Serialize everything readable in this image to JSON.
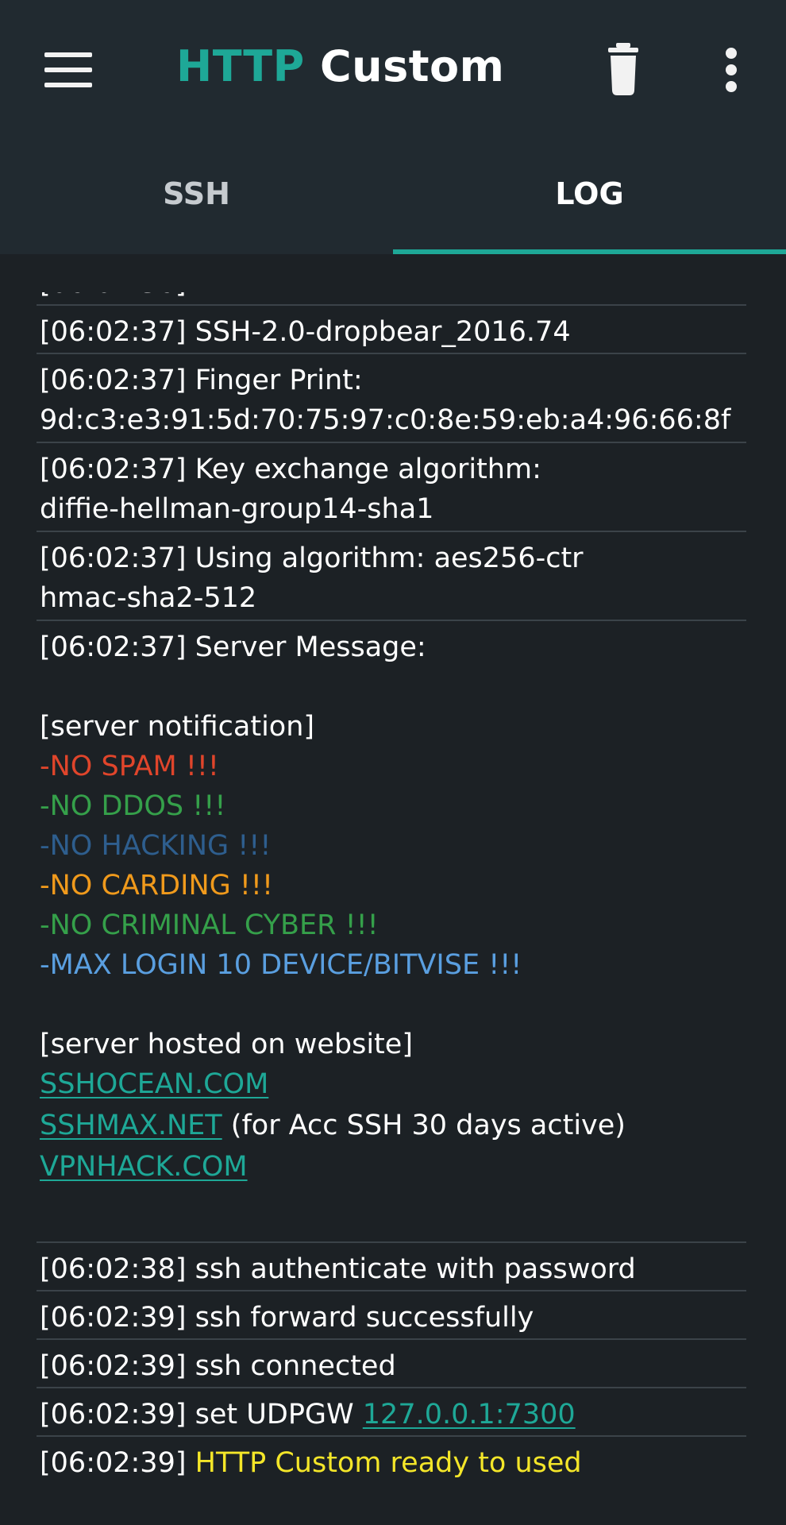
{
  "app": {
    "title_accent": "HTTP",
    "title_rest": "Custom"
  },
  "tabs": [
    {
      "label": "SSH",
      "active": false
    },
    {
      "label": "LOG",
      "active": true
    }
  ],
  "colors": {
    "appbar_bg": "#212a30",
    "body_bg": "#1c2125",
    "accent": "#1ea897",
    "spam": "#e0452b",
    "ddos": "#35a04a",
    "hacking": "#2e5e8e",
    "carding": "#f09a1c",
    "cyber": "#35a04a",
    "maxlogin": "#5a9fe0",
    "ready": "#f4e629"
  },
  "log": {
    "entry_1": "[06:02:37] SSH-2.0-dropbear_2016.74",
    "entry_2_a": "[06:02:37] Finger Print:",
    "entry_2_b": "9d:c3:e3:91:5d:70:75:97:c0:8e:59:eb:a4:96:66:8f",
    "entry_3_a": "[06:02:37] Key exchange algorithm:",
    "entry_3_b": "diffie-hellman-group14-sha1",
    "entry_4_a": "[06:02:37] Using algorithm: aes256-ctr",
    "entry_4_b": "hmac-sha2-512",
    "entry_5_header": "[06:02:37] Server Message:",
    "notification_title": "[server notification]",
    "rule_spam": "-NO SPAM !!!",
    "rule_ddos": "-NO DDOS !!!",
    "rule_hacking": "-NO HACKING !!!",
    "rule_carding": "-NO CARDING !!!",
    "rule_cyber": "-NO CRIMINAL CYBER !!!",
    "rule_maxlogin": "-MAX LOGIN 10 DEVICE/BITVISE !!!",
    "hosted_title": "[server hosted on website]",
    "link_1": "SSHOCEAN.COM",
    "link_2": "SSHMAX.NET",
    "link_2_note": " (for Acc SSH 30 days active)",
    "link_3": "VPNHACK.COM",
    "entry_6": "[06:02:38] ssh authenticate with password",
    "entry_7": "[06:02:39] ssh forward successfully",
    "entry_8": "[06:02:39] ssh connected",
    "entry_9_prefix": "[06:02:39] set UDPGW ",
    "entry_9_link": "127.0.0.1:7300",
    "entry_10_prefix": "[06:02:39] ",
    "entry_10_ready": "HTTP Custom ready to used"
  }
}
